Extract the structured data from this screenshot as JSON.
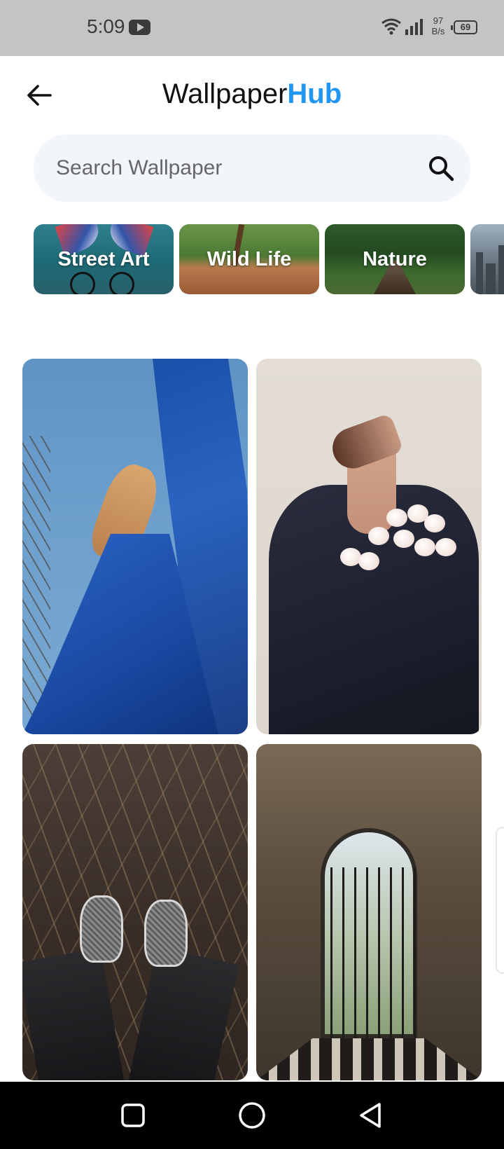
{
  "status_bar": {
    "time": "5:09",
    "network_speed_value": "97",
    "network_speed_unit": "B/s",
    "battery": "69",
    "icons": [
      "youtube-icon",
      "wifi-icon",
      "signal-icon",
      "battery-icon"
    ]
  },
  "header": {
    "title_part1": "Wallpaper",
    "title_part2": "Hub",
    "accent_color": "#2196f3",
    "back_icon": "arrow-left-icon"
  },
  "search": {
    "placeholder": "Search Wallpaper",
    "value": "",
    "icon": "search-icon"
  },
  "categories": [
    {
      "label": "Street Art"
    },
    {
      "label": "Wild Life"
    },
    {
      "label": "Nature"
    },
    {
      "label": ""
    }
  ],
  "wallpapers": [
    {
      "name": "woman-blue-fabric"
    },
    {
      "name": "woman-black-suit-roses"
    },
    {
      "name": "sneakers-on-straw"
    },
    {
      "name": "arched-gate-corridor"
    }
  ],
  "nav_bar": {
    "icons": [
      "recents-square-icon",
      "home-circle-icon",
      "back-triangle-icon"
    ]
  }
}
